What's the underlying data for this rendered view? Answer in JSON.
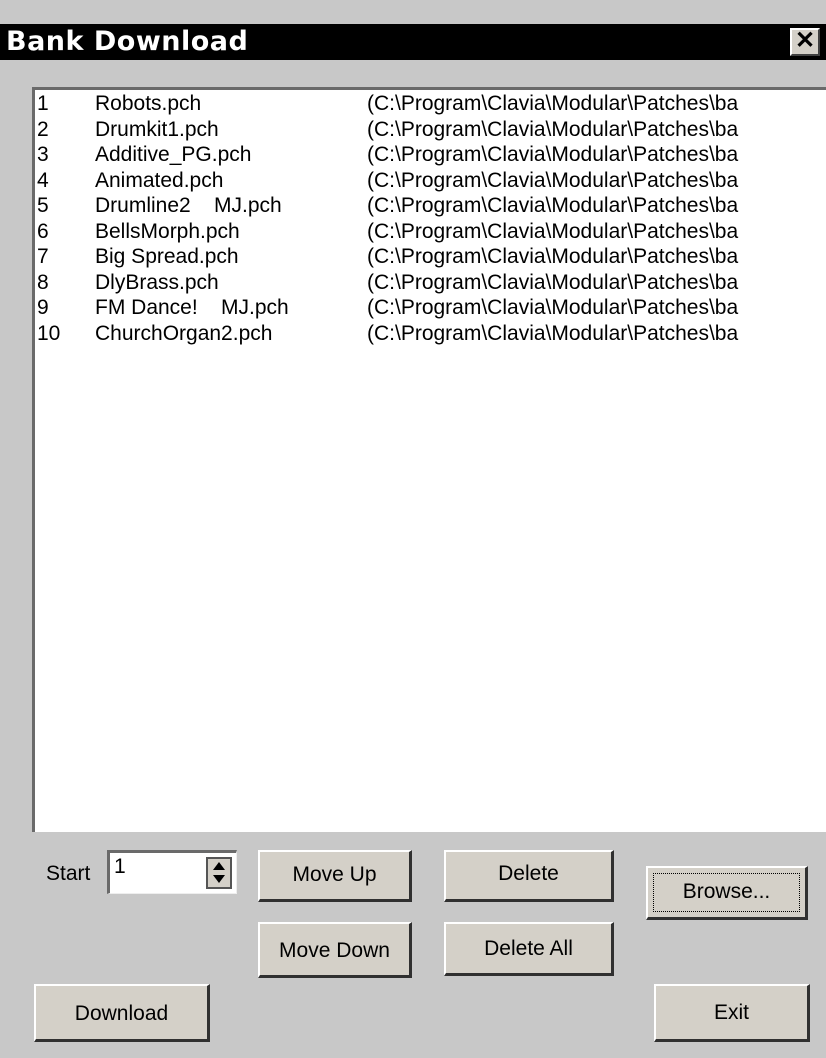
{
  "window": {
    "title": "Bank Download",
    "close_icon": "close-icon",
    "close_glyph": "✕"
  },
  "patch_list": [
    {
      "num": "1",
      "name": "Robots.pch",
      "path": "(C:\\Program\\Clavia\\Modular\\Patches\\ba"
    },
    {
      "num": "2",
      "name": "Drumkit1.pch",
      "path": "(C:\\Program\\Clavia\\Modular\\Patches\\ba"
    },
    {
      "num": "3",
      "name": "Additive_PG.pch",
      "path": "(C:\\Program\\Clavia\\Modular\\Patches\\ba"
    },
    {
      "num": "4",
      "name": "Animated.pch",
      "path": "(C:\\Program\\Clavia\\Modular\\Patches\\ba"
    },
    {
      "num": "5",
      "name": "Drumline2    MJ.pch",
      "path": "(C:\\Program\\Clavia\\Modular\\Patches\\ba"
    },
    {
      "num": "6",
      "name": "BellsMorph.pch",
      "path": "(C:\\Program\\Clavia\\Modular\\Patches\\ba"
    },
    {
      "num": "7",
      "name": "Big Spread.pch",
      "path": "(C:\\Program\\Clavia\\Modular\\Patches\\ba"
    },
    {
      "num": "8",
      "name": "DlyBrass.pch",
      "path": "(C:\\Program\\Clavia\\Modular\\Patches\\ba"
    },
    {
      "num": "9",
      "name": "FM Dance!    MJ.pch",
      "path": "(C:\\Program\\Clavia\\Modular\\Patches\\ba"
    },
    {
      "num": "10",
      "name": "ChurchOrgan2.pch",
      "path": "(C:\\Program\\Clavia\\Modular\\Patches\\ba"
    }
  ],
  "controls": {
    "start_label": "Start",
    "start_value": "1",
    "move_up": "Move Up",
    "move_down": "Move Down",
    "delete": "Delete",
    "delete_all": "Delete All",
    "browse": "Browse...",
    "download": "Download",
    "exit": "Exit"
  }
}
